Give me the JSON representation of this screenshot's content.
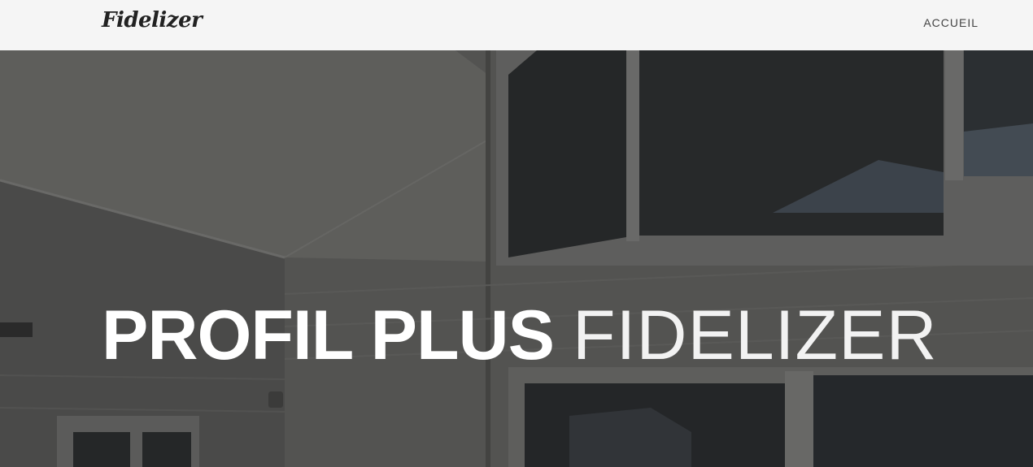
{
  "navbar": {
    "brand": "Fidelizer",
    "links": [
      {
        "label": "ACCUEIL"
      }
    ]
  },
  "hero": {
    "title_bold": "PROFIL PLUS",
    "title_light": "FIDELIZER",
    "background": "house-exterior-photo"
  }
}
